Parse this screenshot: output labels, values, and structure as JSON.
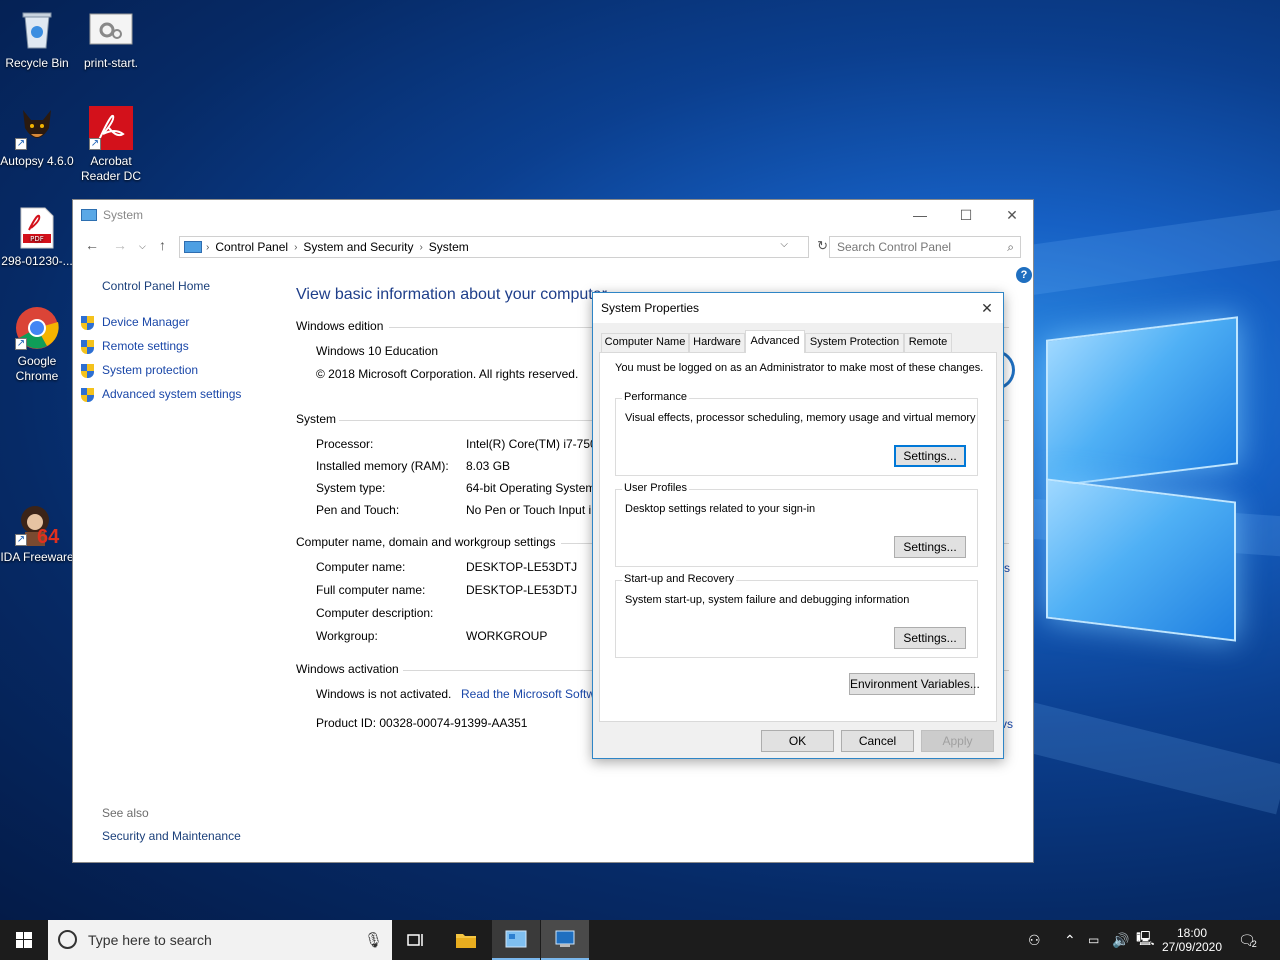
{
  "desktop": {
    "icons": [
      {
        "label": "Recycle Bin",
        "icon": "recycle-bin-icon"
      },
      {
        "label": "print-start.",
        "icon": "settings-file-icon"
      },
      {
        "label": "Autopsy 4.6.0",
        "icon": "autopsy-dog-icon"
      },
      {
        "label": "Acrobat Reader DC",
        "icon": "acrobat-icon"
      },
      {
        "label": "298-01230-...",
        "icon": "pdf-file-icon"
      },
      {
        "label": "Google Chrome",
        "icon": "chrome-icon"
      },
      {
        "label": "IDA Freeware",
        "icon": "ida-icon"
      }
    ],
    "ida_badge": "64"
  },
  "system_window": {
    "title": "System",
    "address": {
      "segments": [
        "Control Panel",
        "System and Security",
        "System"
      ],
      "search_placeholder": "Search Control Panel"
    },
    "help": "?",
    "leftnav": {
      "home": "Control Panel Home",
      "links": [
        "Device Manager",
        "Remote settings",
        "System protection",
        "Advanced system settings"
      ],
      "see_also": "See also",
      "see_also_link": "Security and Maintenance"
    },
    "page_title": "View basic information about your computer",
    "windows_edition": {
      "heading": "Windows edition",
      "edition": "Windows 10 Education",
      "copyright": "© 2018 Microsoft Corporation. All rights reserved."
    },
    "system": {
      "heading": "System",
      "rows": [
        {
          "key": "Processor:",
          "value": "Intel(R) Core(TM) i7-750"
        },
        {
          "key": "Installed memory (RAM):",
          "value": "8.03 GB"
        },
        {
          "key": "System type:",
          "value": "64-bit Operating System"
        },
        {
          "key": "Pen and Touch:",
          "value": "No Pen or Touch Input i"
        }
      ]
    },
    "computer_name": {
      "heading": "Computer name, domain and workgroup settings",
      "rows": [
        {
          "key": "Computer name:",
          "value": "DESKTOP-LE53DTJ"
        },
        {
          "key": "Full computer name:",
          "value": "DESKTOP-LE53DTJ"
        },
        {
          "key": "Computer description:",
          "value": ""
        },
        {
          "key": "Workgroup:",
          "value": "WORKGROUP"
        }
      ],
      "edge_link": "s"
    },
    "activation": {
      "heading": "Windows activation",
      "status": "Windows is not activated.",
      "link": "Read the Microsoft Softw",
      "product_id": "Product ID:  00328-00074-91399-AA351",
      "edge_link": "vs"
    }
  },
  "system_properties": {
    "title": "System Properties",
    "tabs": [
      "Computer Name",
      "Hardware",
      "Advanced",
      "System Protection",
      "Remote"
    ],
    "selected_tab": "Advanced",
    "admin_note": "You must be logged on as an Administrator to make most of these changes.",
    "groups": [
      {
        "title": "Performance",
        "desc": "Visual effects, processor scheduling, memory usage and virtual memory",
        "button": "Settings..."
      },
      {
        "title": "User Profiles",
        "desc": "Desktop settings related to your sign-in",
        "button": "Settings..."
      },
      {
        "title": "Start-up and Recovery",
        "desc": "System start-up, system failure and debugging information",
        "button": "Settings..."
      }
    ],
    "env_button": "Environment Variables...",
    "ok": "OK",
    "cancel": "Cancel",
    "apply": "Apply"
  },
  "taskbar": {
    "search_placeholder": "Type here to search",
    "time": "18:00",
    "date": "27/09/2020",
    "notification_count": "2"
  }
}
